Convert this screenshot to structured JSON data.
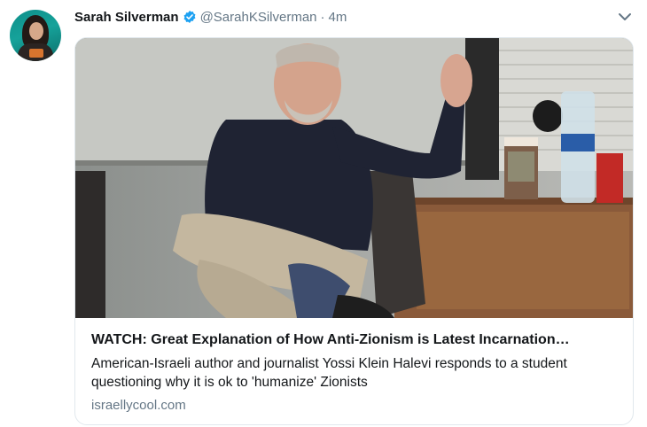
{
  "tweet": {
    "author_name": "Sarah Silverman",
    "handle": "@SarahKSilverman",
    "separator": "·",
    "timestamp": "4m",
    "verified": true
  },
  "link_card": {
    "title": "WATCH: Great Explanation of How Anti-Zionism is Latest Incarnation…",
    "description": "American-Israeli author and journalist Yossi Klein Halevi responds to a student questioning why it is ok to 'humanize' Zionists",
    "domain": "israellycool.com"
  },
  "icons": {
    "verified": "verified-badge-icon",
    "caret": "chevron-down-icon"
  },
  "colors": {
    "verified_blue": "#1da1f2",
    "text_primary": "#14171a",
    "text_secondary": "#657786",
    "card_border": "#e1e8ed"
  }
}
